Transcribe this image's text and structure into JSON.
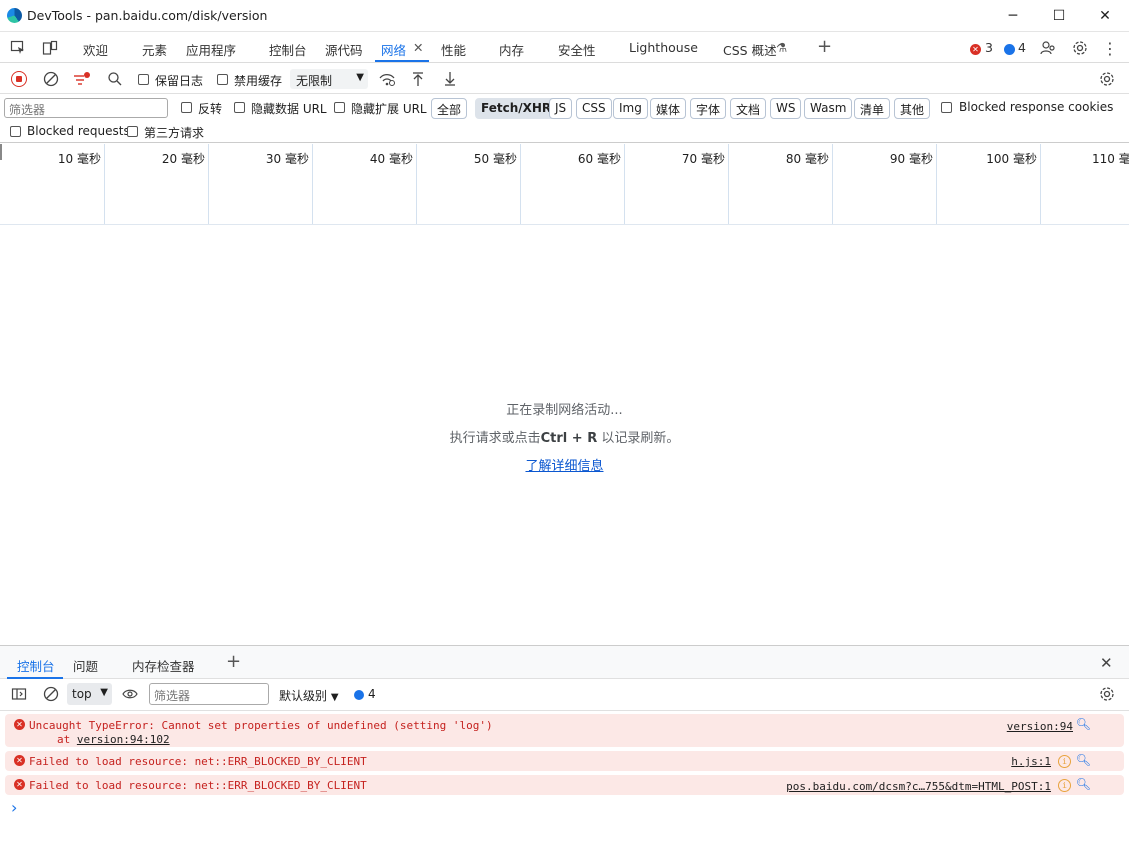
{
  "window": {
    "title": "DevTools - pan.baidu.com/disk/version",
    "minimize": "─",
    "maximize": "☐",
    "close": "✕"
  },
  "tabs": [
    {
      "label": "欢迎"
    },
    {
      "label": "元素"
    },
    {
      "label": "应用程序"
    },
    {
      "label": "控制台"
    },
    {
      "label": "源代码"
    },
    {
      "label": "网络",
      "active": true
    },
    {
      "label": "性能"
    },
    {
      "label": "内存"
    },
    {
      "label": "安全性"
    },
    {
      "label": "Lighthouse"
    },
    {
      "label": "CSS 概述"
    }
  ],
  "tab_close": "✕",
  "tab_add": "+",
  "badges": {
    "errors": "3",
    "messages": "4"
  },
  "toolbar": {
    "preserve_log": "保留日志",
    "disable_cache": "禁用缓存",
    "throttle": "无限制"
  },
  "filter": {
    "placeholder": "筛选器",
    "invert": "反转",
    "hide_data_url": "隐藏数据 URL",
    "hide_ext_url": "隐藏扩展 URL",
    "types": [
      "全部",
      "Fetch/XHR",
      "JS",
      "CSS",
      "Img",
      "媒体",
      "字体",
      "文档",
      "WS",
      "Wasm",
      "清单",
      "其他"
    ],
    "selected_type": "Fetch/XHR",
    "blocked_cookies": "Blocked response cookies",
    "blocked_requests": "Blocked requests",
    "third_party": "第三方请求"
  },
  "timeline": {
    "ticks": [
      "10  毫秒",
      "20  毫秒",
      "30  毫秒",
      "40  毫秒",
      "50  毫秒",
      "60  毫秒",
      "70  毫秒",
      "80  毫秒",
      "90  毫秒",
      "100  毫秒",
      "110  毫"
    ]
  },
  "empty": {
    "line1": "正在录制网络活动...",
    "line2_pre": "执行请求或点击",
    "line2_key": "Ctrl + R",
    "line2_post": " 以记录刷新。",
    "link": "了解详细信息"
  },
  "drawer": {
    "tabs": [
      "控制台",
      "问题",
      "内存检查器"
    ],
    "context": "top",
    "filter_placeholder": "筛选器",
    "level": "默认级别",
    "msg_count": "4",
    "messages": [
      {
        "text": "Uncaught TypeError: Cannot set properties of undefined (setting 'log')",
        "sub_pre": "at ",
        "sub_link": "version:94:102",
        "source": "version:94"
      },
      {
        "text": "Failed to load resource: net::ERR_BLOCKED_BY_CLIENT",
        "source": "h.js:1"
      },
      {
        "text": "Failed to load resource: net::ERR_BLOCKED_BY_CLIENT",
        "source": "pos.baidu.com/dcsm?c…755&dtm=HTML_POST:1"
      }
    ],
    "prompt": "›"
  },
  "colors": {
    "accent": "#1a73e8",
    "error": "#d93025",
    "error_bg": "#fce8e6"
  }
}
